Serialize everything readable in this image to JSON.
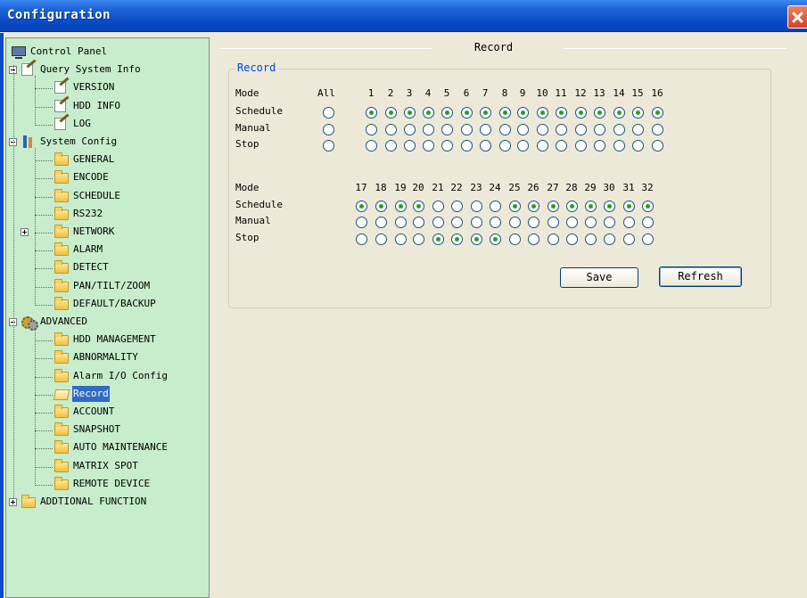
{
  "window": {
    "title": "Configuration"
  },
  "tree": [
    {
      "label": "Control Panel",
      "icon": "monitor-icon",
      "level": 0
    },
    {
      "label": "Query System Info",
      "icon": "edit-doc-icon",
      "level": 1,
      "expander": "minus"
    },
    {
      "label": "VERSION",
      "icon": "edit-doc-icon",
      "level": 2
    },
    {
      "label": "HDD INFO",
      "icon": "edit-doc-icon",
      "level": 2
    },
    {
      "label": "LOG",
      "icon": "edit-doc-icon",
      "level": 2
    },
    {
      "label": "System Config",
      "icon": "tools-icon",
      "level": 1,
      "expander": "minus"
    },
    {
      "label": "GENERAL",
      "icon": "folder-icon",
      "level": 2
    },
    {
      "label": "ENCODE",
      "icon": "folder-icon",
      "level": 2
    },
    {
      "label": "SCHEDULE",
      "icon": "folder-icon",
      "level": 2
    },
    {
      "label": "RS232",
      "icon": "folder-icon",
      "level": 2
    },
    {
      "label": "NETWORK",
      "icon": "folder-icon",
      "level": 2,
      "expander": "plus"
    },
    {
      "label": "ALARM",
      "icon": "folder-icon",
      "level": 2
    },
    {
      "label": "DETECT",
      "icon": "folder-icon",
      "level": 2
    },
    {
      "label": "PAN/TILT/ZOOM",
      "icon": "folder-icon",
      "level": 2
    },
    {
      "label": "DEFAULT/BACKUP",
      "icon": "folder-icon",
      "level": 2
    },
    {
      "label": "ADVANCED",
      "icon": "gears-icon",
      "level": 1,
      "expander": "minus"
    },
    {
      "label": "HDD MANAGEMENT",
      "icon": "folder-icon",
      "level": 2
    },
    {
      "label": "ABNORMALITY",
      "icon": "folder-icon",
      "level": 2
    },
    {
      "label": "Alarm I/O Config",
      "icon": "folder-icon",
      "level": 2
    },
    {
      "label": "Record",
      "icon": "folder-open-icon",
      "level": 2,
      "selected": true
    },
    {
      "label": "ACCOUNT",
      "icon": "folder-icon",
      "level": 2
    },
    {
      "label": "SNAPSHOT",
      "icon": "folder-icon",
      "level": 2
    },
    {
      "label": "AUTO MAINTENANCE",
      "icon": "folder-icon",
      "level": 2
    },
    {
      "label": "MATRIX SPOT",
      "icon": "folder-icon",
      "level": 2
    },
    {
      "label": "REMOTE DEVICE",
      "icon": "folder-icon",
      "level": 2
    },
    {
      "label": "ADDTIONAL FUNCTION",
      "icon": "folder-icon",
      "level": 1,
      "expander": "plus"
    }
  ],
  "panel": {
    "title": "Record",
    "group_label": "Record",
    "mode_label": "Mode",
    "all_label": "All",
    "rows": [
      "Schedule",
      "Manual",
      "Stop"
    ],
    "block1": {
      "channels": [
        "1",
        "2",
        "3",
        "4",
        "5",
        "6",
        "7",
        "8",
        "9",
        "10",
        "11",
        "12",
        "13",
        "14",
        "15",
        "16"
      ],
      "all_selected": null,
      "selected": [
        "Schedule",
        "Schedule",
        "Schedule",
        "Schedule",
        "Schedule",
        "Schedule",
        "Schedule",
        "Schedule",
        "Schedule",
        "Schedule",
        "Schedule",
        "Schedule",
        "Schedule",
        "Schedule",
        "Schedule",
        "Schedule"
      ]
    },
    "block2": {
      "channels": [
        "17",
        "18",
        "19",
        "20",
        "21",
        "22",
        "23",
        "24",
        "25",
        "26",
        "27",
        "28",
        "29",
        "30",
        "31",
        "32"
      ],
      "selected": [
        "Schedule",
        "Schedule",
        "Schedule",
        "Schedule",
        "Stop",
        "Stop",
        "Stop",
        "Stop",
        "Schedule",
        "Schedule",
        "Schedule",
        "Schedule",
        "Schedule",
        "Schedule",
        "Schedule",
        "Schedule"
      ]
    },
    "buttons": {
      "save": "Save",
      "refresh": "Refresh"
    }
  }
}
